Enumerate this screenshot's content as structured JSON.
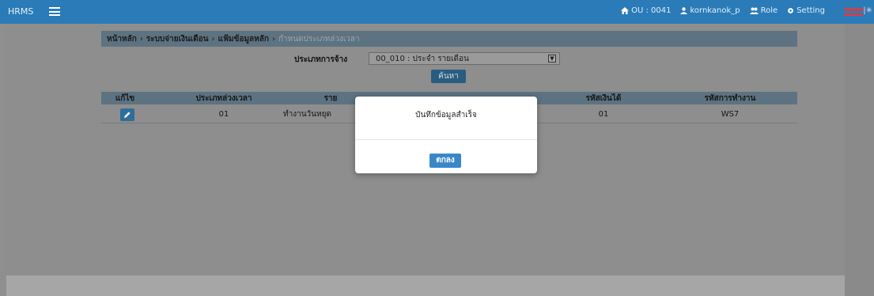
{
  "topbar": {
    "brand": "HRMS",
    "ou": "OU : 0041",
    "user": "kornkanok_p",
    "role": "Role",
    "setting": "Setting"
  },
  "breadcrumb": [
    "หน้าหลัก",
    "ระบบจ่ายเงินเดือน",
    "แฟ้มข้อมูลหลัก",
    "กำหนดประเภทล่วงเวลา"
  ],
  "filter": {
    "label": "ประเภทการจ้าง",
    "value": "00_010 : ประจำ รายเดือน",
    "search_label": "ค้นหา"
  },
  "table": {
    "headers": [
      "แก้ไข",
      "ประเภทล่วงเวลา",
      "ราย",
      "รหัสเงินได้",
      "รหัสการทำงาน"
    ],
    "rows": [
      {
        "ot_type": "01",
        "desc": "ทำงานวันหยุด",
        "income_code": "01",
        "work_code": "WS7"
      }
    ]
  },
  "modal": {
    "message": "บันทึกข้อมูลสำเร็จ",
    "ok_label": "ตกลง"
  },
  "colors": {
    "topbar": "#2a7bb8",
    "overlay": "#8e8e8e",
    "button": "#3a87c8"
  }
}
